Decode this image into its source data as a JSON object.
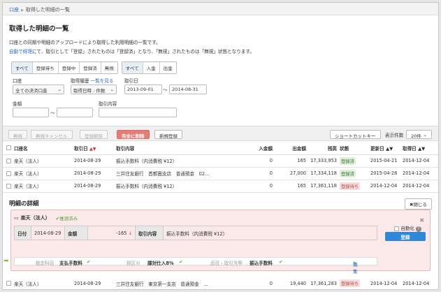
{
  "breadcrumb": {
    "root": "口座",
    "current": "取得した明細の一覧"
  },
  "page": {
    "title": "取得した明細の一覧",
    "desc1": "口座との同期や明細のアップロードにより取得した利用明細の一覧です。",
    "desc2_link": "自動で経理",
    "desc2_rest": "にて、取引として「登録」されたものは「登録済」となり、「無視」されたものは「無視」状態となります。"
  },
  "filters": {
    "status_tabs": [
      "すべて",
      "登録待ち",
      "登録中",
      "登録済",
      "無視"
    ],
    "flow_tabs": [
      "すべて",
      "入金",
      "出金"
    ],
    "account_label": "口座",
    "account_value": "全ての決済口座",
    "history_label": "取得履歴",
    "history_link": "一覧を見る",
    "history_value": "取得日時 : 件数",
    "date_label": "取引日",
    "date_from": "2013-09-01",
    "date_sep": "〜",
    "date_to": "2014-08-31",
    "amount_label": "金額",
    "amount_sep": "〜",
    "content_label": "取引内容"
  },
  "toolbar": {
    "ignore": "無視",
    "ignore_cancel": "無視キャンセル",
    "unregister": "登録解除",
    "delete": "完全に削除",
    "new": "新規登録",
    "shortcut": "ショートカットキー",
    "per_page_label": "表示件数",
    "per_page_value": "20件"
  },
  "table": {
    "headers": [
      "口座名",
      "取引日",
      "取引内容",
      "入金額",
      "出金額",
      "残高",
      "状態",
      "更新日",
      "取得日"
    ],
    "rows": [
      {
        "account": "楽天（法人）",
        "date": "2014-08-29",
        "content": "振込手数料（内消費税 ¥12）",
        "in": "0",
        "out": "165",
        "bal": "17,333,953",
        "status": "登録済",
        "status_type": "done",
        "updated": "2015-04-21",
        "fetched": "2014-12-04"
      },
      {
        "account": "楽天（法人）",
        "date": "2014-08-29",
        "content": "三井住友銀行　首都圏支店　普通預金　02...",
        "in": "0",
        "out": "27,000",
        "bal": "17,334,118",
        "status": "登録済",
        "status_type": "done",
        "updated": "2015-04-28",
        "fetched": "2014-12-04"
      },
      {
        "account": "楽天（法人）",
        "date": "2014-08-29",
        "content": "振込手数料（内消費税 ¥12）",
        "in": "0",
        "out": "165",
        "bal": "17,361,118",
        "status": "登録待ち",
        "status_type": "wait",
        "updated": "2014-12-04",
        "fetched": "2014-12-04"
      }
    ],
    "last_row": {
      "account": "楽天（法人）",
      "date": "2014-08-29",
      "content": "三井住友銀行　東京第一支店　普通預金　...",
      "in": "0",
      "out": "19,440",
      "bal": "17,361,283",
      "status": "登録待ち",
      "status_type": "wait",
      "updated": "2014-12-04",
      "fetched": "2014-12-04"
    }
  },
  "detail": {
    "section_title": "明細の詳細",
    "close": "閉じる",
    "account": "楽天（法人）",
    "matched": "推測済み",
    "date_label": "日付",
    "date_value": "2014-08-29",
    "amount_label": "金額",
    "amount_value": "-165",
    "content_label": "取引内容",
    "content_value": "振込手数料（内消費税 ¥12）",
    "auto_label": "自動化",
    "register": "登録",
    "sub": {
      "account_item_label": "勘定科目",
      "account_item_value": "支払手数料",
      "tax_label": "税区分",
      "tax_value": "課対仕入8%",
      "partner_label": "品目・取引先等",
      "partner_value": "振込手数料",
      "edit": "編集"
    }
  }
}
